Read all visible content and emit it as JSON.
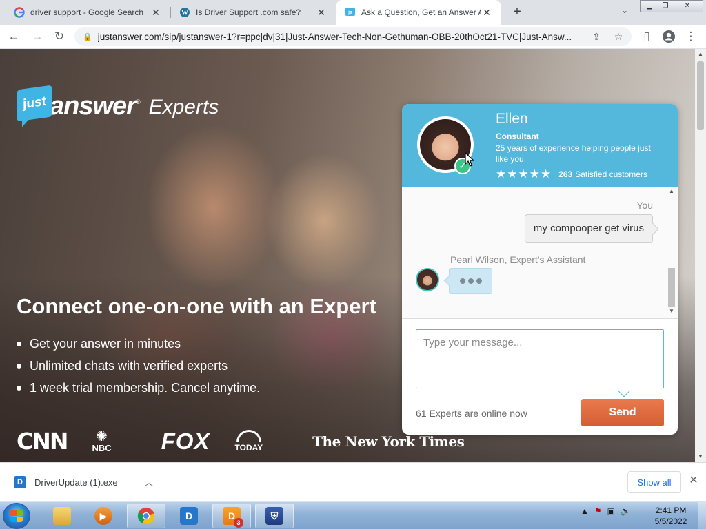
{
  "browser": {
    "tabs": [
      {
        "title": "driver support - Google Search",
        "icon": "google-icon",
        "active": false
      },
      {
        "title": "Is Driver Support .com safe?",
        "icon": "wordpress-icon",
        "active": false
      },
      {
        "title": "Ask a Question, Get an Answer A",
        "icon": "justanswer-icon",
        "active": true
      }
    ],
    "new_tab": "+",
    "url": "justanswer.com/sip/justanswer-1?r=ppc|dv|31|Just-Answer-Tech-Non-Gethuman-OBB-20thOct21-TVC|Just-Answ..."
  },
  "page": {
    "logo": {
      "badge": "just",
      "word": "answer",
      "reg": "®",
      "suffix": "Experts"
    },
    "headline": "Connect one-on-one with an Expert",
    "bullets": [
      "Get your answer in minutes",
      "Unlimited chats with verified experts",
      "1 week trial membership. Cancel anytime."
    ],
    "press": {
      "cnn": "CNN",
      "nbc": "NBC",
      "fox": "FOX",
      "today": "TODAY",
      "nyt": "The New York Times"
    }
  },
  "chat": {
    "expert": {
      "name": "Ellen",
      "role": "Consultant",
      "description": "25 years of experience helping people just like you",
      "stars": "★★★★★",
      "rating": 5,
      "satisfied_count": "263",
      "satisfied_label": "Satisfied customers"
    },
    "you_label": "You",
    "user_message": "my compooper get virus",
    "assistant_label": "Pearl Wilson, Expert's Assistant",
    "input_placeholder": "Type your message...",
    "online_text": "61 Experts are online now",
    "send_label": "Send"
  },
  "downloads": {
    "file": "DriverUpdate (1).exe",
    "show_all": "Show all"
  },
  "taskbar": {
    "clock_time": "2:41 PM",
    "clock_date": "5/5/2022",
    "d3_badge": "3"
  },
  "colors": {
    "chat_header": "#54b8dc",
    "send_button": "#e06b40",
    "justanswer_blue": "#40b4e5"
  }
}
